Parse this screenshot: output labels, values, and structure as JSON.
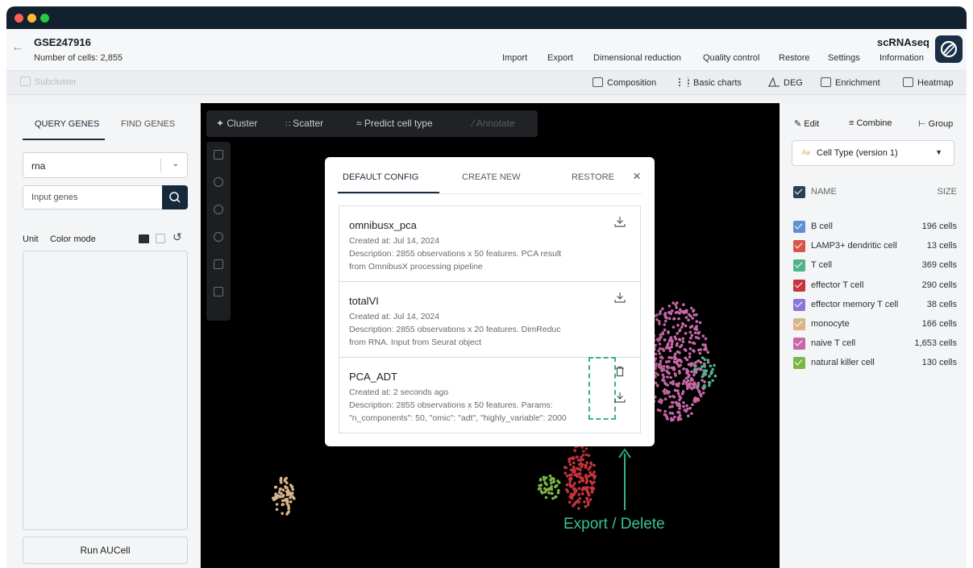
{
  "window": {
    "traffic_lights": [
      {
        "name": "close",
        "color": "#ff5f57"
      },
      {
        "name": "minimize",
        "color": "#febc2e"
      },
      {
        "name": "maximize",
        "color": "#28c840"
      }
    ]
  },
  "header": {
    "title": "GSE247916",
    "cell_count": "Number of cells: 2,855",
    "app_name": "scRNAseq",
    "menu": [
      "Import",
      "Export",
      "Dimensional reduction",
      "Quality control",
      "Restore",
      "Settings",
      "Information"
    ]
  },
  "toolbar": {
    "subcluster": "Subcluster",
    "tools": [
      "Composition",
      "Basic charts",
      "DEG",
      "Enrichment",
      "Heatmap"
    ]
  },
  "left_panel": {
    "tabs": [
      "QUERY GENES",
      "FIND GENES"
    ],
    "active_tab": "QUERY GENES",
    "assay_value": "rna",
    "gene_input_placeholder": "Input genes",
    "unit_label": "Unit",
    "color_mode_label": "Color mode",
    "run_button": "Run AUCell"
  },
  "canvas": {
    "tools": [
      "Cluster",
      "Scatter",
      "Predict cell type",
      "Annotate"
    ],
    "annotation_label": "Export / Delete",
    "annotation_color": "#3cc196"
  },
  "modal": {
    "tabs": [
      "DEFAULT CONFIG",
      "CREATE NEW",
      "RESTORE"
    ],
    "active_tab": "DEFAULT CONFIG",
    "items": [
      {
        "name": "omnibusx_pca",
        "created": "Created at: Jul 14, 2024",
        "desc_line1": "Description: 2855 observations x 50 features. PCA result",
        "desc_line2": "from OmnibusX processing pipeline"
      },
      {
        "name": "totalVI",
        "created": "Created at: Jul 14, 2024",
        "desc_line1": "Description: 2855 observations x 20 features. DimReduc",
        "desc_line2": "from RNA. Input from Seurat object"
      },
      {
        "name": "PCA_ADT",
        "created": "Created at: 2 seconds ago",
        "desc_line1": "Description: 2855 observations x 50 features. Params:",
        "desc_line2": "\"n_components\": 50, \"omic\": \"adt\", \"highly_variable\": 2000"
      }
    ]
  },
  "right_panel": {
    "actions": [
      "Edit",
      "Combine",
      "Group"
    ],
    "cell_type_select": "Cell Type (version 1)",
    "aa_badge": "Aa",
    "col_name": "NAME",
    "col_size": "SIZE",
    "cell_types": [
      {
        "name": "B cell",
        "size": "196 cells",
        "color": "#5b8fd6"
      },
      {
        "name": "LAMP3+ dendritic cell",
        "size": "13 cells",
        "color": "#d9534b"
      },
      {
        "name": "T cell",
        "size": "369 cells",
        "color": "#4fb38a"
      },
      {
        "name": "effector T cell",
        "size": "290 cells",
        "color": "#c8343c"
      },
      {
        "name": "effector memory T cell",
        "size": "38 cells",
        "color": "#8a76d6"
      },
      {
        "name": "monocyte",
        "size": "166 cells",
        "color": "#d9b38a"
      },
      {
        "name": "naive T cell",
        "size": "1,653 cells",
        "color": "#c868a8"
      },
      {
        "name": "natural killer cell",
        "size": "130 cells",
        "color": "#7bb648"
      }
    ]
  }
}
